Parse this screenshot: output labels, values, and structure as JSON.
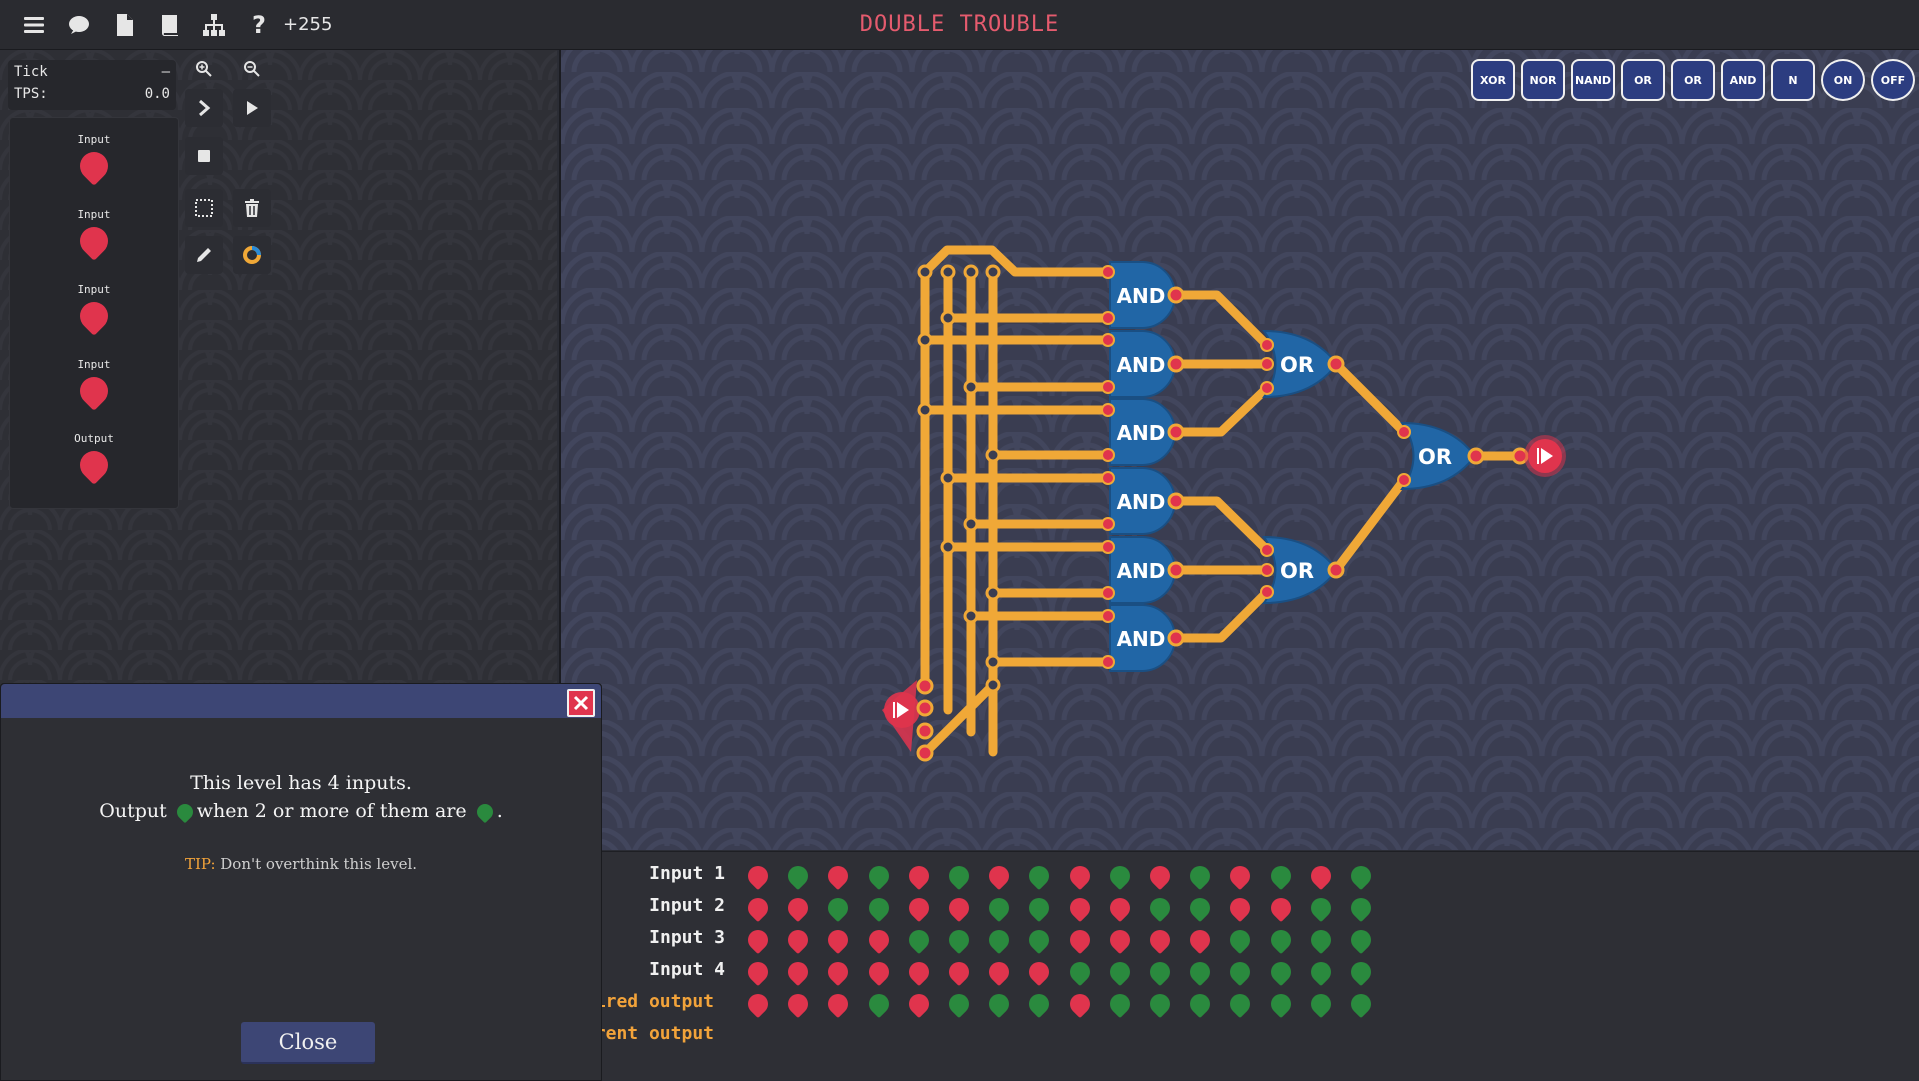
{
  "topbar": {
    "icons": [
      "menu-icon",
      "chat-icon",
      "document-icon",
      "book-icon",
      "hierarchy-icon",
      "help-icon"
    ],
    "help_glyph": "?",
    "score": "+255",
    "title": "DOUBLE TROUBLE"
  },
  "tick_panel": {
    "tick_label": "Tick",
    "tick_value": "–",
    "tps_label": "TPS:",
    "tps_value": "0.0"
  },
  "io_panel": {
    "items": [
      {
        "label": "Input",
        "state": "off"
      },
      {
        "label": "Input",
        "state": "off"
      },
      {
        "label": "Input",
        "state": "off"
      },
      {
        "label": "Input",
        "state": "off"
      },
      {
        "label": "Output",
        "state": "off"
      }
    ]
  },
  "tools": [
    "zoom-in-icon",
    "zoom-out-icon",
    "step-icon",
    "play-icon",
    "stop-icon",
    "select-icon",
    "trash-icon",
    "pencil-icon",
    "wire-color-icon"
  ],
  "toolbox": [
    "XOR",
    "NOR",
    "NAND",
    "OR",
    "OR",
    "AND",
    "N",
    "ON",
    "OFF"
  ],
  "circuit": {
    "and_gates": [
      "AND",
      "AND",
      "AND",
      "AND",
      "AND",
      "AND"
    ],
    "or_gates": [
      "OR",
      "OR",
      "OR"
    ]
  },
  "truth_table": {
    "rows": [
      {
        "label": "Input 1",
        "values": [
          0,
          1,
          0,
          1,
          0,
          1,
          0,
          1,
          0,
          1,
          0,
          1,
          0,
          1,
          0,
          1
        ]
      },
      {
        "label": "Input 2",
        "values": [
          0,
          0,
          1,
          1,
          0,
          0,
          1,
          1,
          0,
          0,
          1,
          1,
          0,
          0,
          1,
          1
        ]
      },
      {
        "label": "Input 3",
        "values": [
          0,
          0,
          0,
          0,
          1,
          1,
          1,
          1,
          0,
          0,
          0,
          0,
          1,
          1,
          1,
          1
        ]
      },
      {
        "label": "Input 4",
        "values": [
          0,
          0,
          0,
          0,
          0,
          0,
          0,
          0,
          1,
          1,
          1,
          1,
          1,
          1,
          1,
          1
        ]
      },
      {
        "label": "ired output",
        "values": [
          0,
          0,
          0,
          1,
          0,
          1,
          1,
          1,
          0,
          1,
          1,
          1,
          1,
          1,
          1,
          1
        ]
      },
      {
        "label": "rent output",
        "values": []
      }
    ],
    "colors": {
      "on": "#2a8a3e",
      "off": "#e0344d"
    }
  },
  "dialog": {
    "line1": "This level has 4 inputs.",
    "line2_a": "Output",
    "line2_b": "when 2 or more of them are",
    "line2_c": ".",
    "tip_label": "TIP:",
    "tip_text": " Don't overthink this level.",
    "close_label": "Close"
  },
  "colors": {
    "wire": "#f0a837",
    "gate": "#2166a6",
    "red": "#e0344d",
    "green": "#2a8a3e",
    "title": "#e55b6e"
  }
}
